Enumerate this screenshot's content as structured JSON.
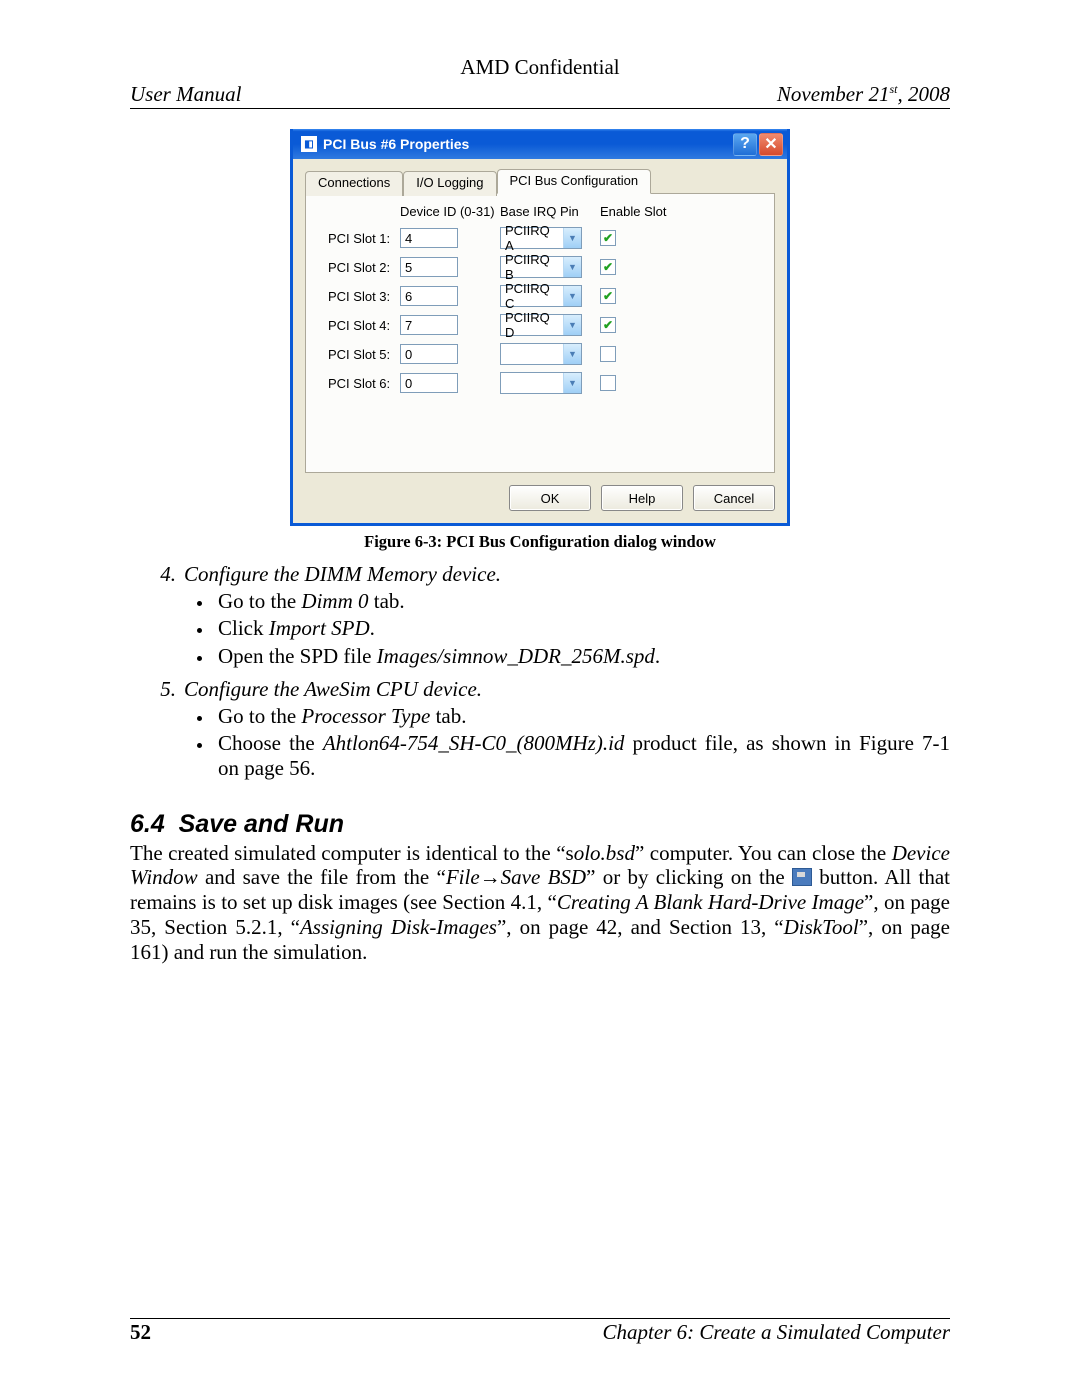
{
  "header": {
    "confidential": "AMD Confidential",
    "left": "User Manual",
    "right_prefix": "November 21",
    "right_sup": "st",
    "right_suffix": ", 2008"
  },
  "dialog": {
    "title": "PCI Bus #6 Properties",
    "tabs": [
      "Connections",
      "I/O Logging",
      "PCI Bus Configuration"
    ],
    "active_tab": 2,
    "columns": [
      "Device ID (0-31)",
      "Base IRQ Pin",
      "Enable Slot"
    ],
    "slots": [
      {
        "label": "PCI Slot 1:",
        "device": "4",
        "irq": "PCIIRQ A",
        "enabled": true
      },
      {
        "label": "PCI Slot 2:",
        "device": "5",
        "irq": "PCIIRQ B",
        "enabled": true
      },
      {
        "label": "PCI Slot 3:",
        "device": "6",
        "irq": "PCIIRQ C",
        "enabled": true
      },
      {
        "label": "PCI Slot 4:",
        "device": "7",
        "irq": "PCIIRQ D",
        "enabled": true
      },
      {
        "label": "PCI Slot 5:",
        "device": "0",
        "irq": "",
        "enabled": false
      },
      {
        "label": "PCI Slot 6:",
        "device": "0",
        "irq": "",
        "enabled": false
      }
    ],
    "buttons": {
      "ok": "OK",
      "help": "Help",
      "cancel": "Cancel"
    }
  },
  "caption": "Figure 6-3: PCI Bus Configuration dialog window",
  "steps": {
    "s4": {
      "num": "4.",
      "title": "Configure the DIMM Memory device.",
      "b1a": "Go to the ",
      "b1b": "Dimm 0",
      "b1c": " tab.",
      "b2a": "Click ",
      "b2b": "Import SPD",
      "b2c": ".",
      "b3a": "Open the SPD file ",
      "b3b": "Images/simnow_DDR_256M.spd",
      "b3c": "."
    },
    "s5": {
      "num": "5.",
      "title": "Configure the AweSim CPU device.",
      "b1a": "Go to the ",
      "b1b": "Processor Type",
      "b1c": " tab.",
      "b2a": "Choose the ",
      "b2b": "Ahtlon64-754_SH-C0_(800MHz).id",
      "b2c": " product file, as shown in Figure 7-1 on page 56."
    }
  },
  "section": {
    "num": "6.4",
    "title": "Save and Run",
    "p1a": "The created simulated computer is identical to the “s",
    "p1b": "olo.bsd",
    "p1c": "” computer. You can close the ",
    "p1d": "Device Window",
    "p1e": " and save the file from the “",
    "p1f": "File→Save BSD",
    "p1g": "” or by clicking on the ",
    "p2a": " button. All that remains is to set up disk images (see Section 4.1, “",
    "p2b": "Creating A Blank Hard-Drive Image",
    "p2c": "”, on page 35, Section 5.2.1, “",
    "p2d": "Assigning Disk-Images",
    "p2e": "”, on page 42, and Section 13, “",
    "p2f": "DiskTool",
    "p2g": "”, on page 161) and run the simulation."
  },
  "footer": {
    "page": "52",
    "chapter": "Chapter 6: Create a Simulated Computer"
  }
}
